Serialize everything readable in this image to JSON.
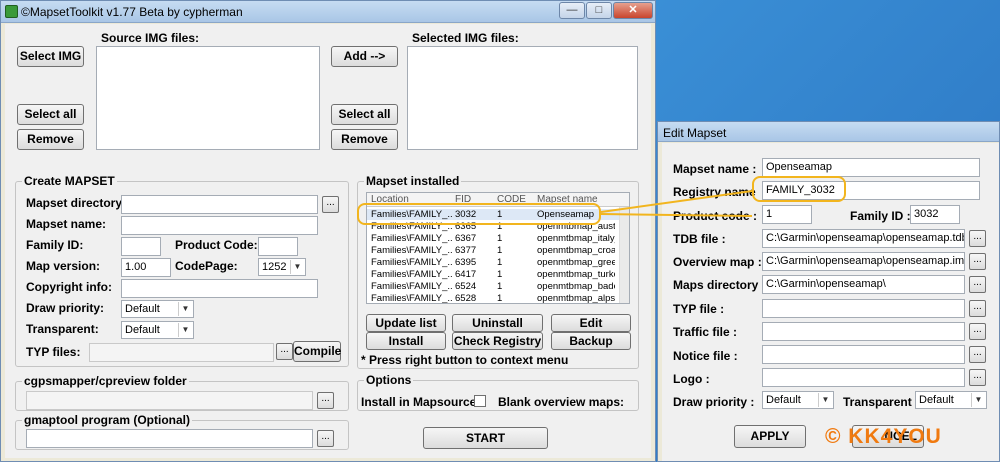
{
  "main_window": {
    "title": "©MapsetToolkit v1.77 Beta by cypherman",
    "controls": {
      "minimize": "—",
      "maximize": "□",
      "close": "✕"
    },
    "source_label": "Source IMG files:",
    "selected_label": "Selected IMG files:",
    "buttons": {
      "select_img": "Select IMG",
      "select_all_left": "Select all",
      "remove_left": "Remove",
      "add": "Add -->",
      "select_all_right": "Select all",
      "remove_right": "Remove",
      "compile": "Compile",
      "start": "START",
      "browse": "..."
    },
    "create_mapset": {
      "title": "Create MAPSET",
      "mapset_directory_label": "Mapset directory:",
      "mapset_name_label": "Mapset name:",
      "family_id_label": "Family ID:",
      "product_code_label": "Product Code:",
      "map_version_label": "Map version:",
      "map_version_value": "1.00",
      "codepage_label": "CodePage:",
      "codepage_value": "1252",
      "copyright_label": "Copyright info:",
      "draw_priority_label": "Draw priority:",
      "draw_priority_value": "Default",
      "transparent_label": "Transparent:",
      "transparent_value": "Default",
      "typ_files_label": "TYP files:"
    },
    "cgpsmapper_title": "cgpsmapper/cpreview folder",
    "gmaptool_title": "gmaptool program (Optional)",
    "mapset_installed": {
      "title": "Mapset installed",
      "columns": [
        "Location",
        "FID",
        "CODE",
        "Mapset name"
      ],
      "rows": [
        {
          "location": "Families\\FAMILY_...",
          "fid": "3032",
          "code": "1",
          "name": "Openseamap"
        },
        {
          "location": "Families\\FAMILY_...",
          "fid": "6365",
          "code": "1",
          "name": "openmtbmap_austria"
        },
        {
          "location": "Families\\FAMILY_...",
          "fid": "6367",
          "code": "1",
          "name": "openmtbmap_italy_l"
        },
        {
          "location": "Families\\FAMILY_...",
          "fid": "6377",
          "code": "1",
          "name": "openmtbmap_croatia"
        },
        {
          "location": "Families\\FAMILY_...",
          "fid": "6395",
          "code": "1",
          "name": "openmtbmap_greece"
        },
        {
          "location": "Families\\FAMILY_...",
          "fid": "6417",
          "code": "1",
          "name": "openmtbmap_turkey"
        },
        {
          "location": "Families\\FAMILY_...",
          "fid": "6524",
          "code": "1",
          "name": "openmtbmap_baden"
        },
        {
          "location": "Families\\FAMILY_...",
          "fid": "6528",
          "code": "1",
          "name": "openmtbmap_alps"
        }
      ],
      "buttons": {
        "update_list": "Update list",
        "uninstall": "Uninstall",
        "edit": "Edit",
        "install": "Install",
        "check_registry": "Check Registry",
        "backup": "Backup"
      },
      "note": "* Press right button to context menu"
    },
    "options": {
      "title": "Options",
      "install_in_mapsource": "Install in Mapsource:",
      "blank_overview": "Blank overview maps:"
    }
  },
  "edit_window": {
    "title": "Edit Mapset",
    "mapset_name_label": "Mapset name :",
    "mapset_name_value": "Openseamap",
    "registry_name_label": "Registry name",
    "registry_name_value": "FAMILY_3032",
    "product_code_label": "Product code :",
    "product_code_value": "1",
    "family_id_label": "Family ID :",
    "family_id_value": "3032",
    "tdb_file_label": "TDB file :",
    "tdb_file_value": "C:\\Garmin\\openseamap\\openseamap.tdb",
    "overview_map_label": "Overview map :",
    "overview_map_value": "C:\\Garmin\\openseamap\\openseamap.img",
    "maps_directory_label": "Maps directory :",
    "maps_directory_value": "C:\\Garmin\\openseamap\\",
    "typ_file_label": "TYP file :",
    "traffic_file_label": "Traffic file :",
    "notice_file_label": "Notice file :",
    "logo_label": "Logo :",
    "draw_priority_label": "Draw priority :",
    "draw_priority_value": "Default",
    "transparent_label": "Transparent :",
    "transparent_value": "Default",
    "apply": "APPLY",
    "cancel_partial": "NCEL",
    "browse": "..."
  },
  "watermark": "© KK4YOU",
  "colors": {
    "highlight": "#f2b51e",
    "watermark": "#f07a10",
    "titlebar": "#b9d1ee"
  }
}
